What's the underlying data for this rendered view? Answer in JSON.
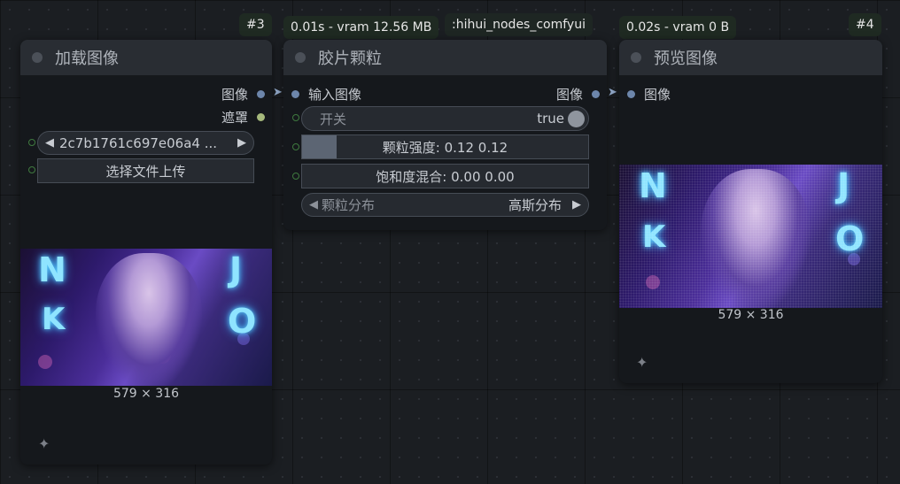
{
  "badges": {
    "node3_id": "#3",
    "node4_id": "#4",
    "grain_time": "0.01s - vram 12.56 MB",
    "grain_pack": ":hihui_nodes_comfyui",
    "preview_time": "0.02s - vram 0 B"
  },
  "load_node": {
    "title": "加载图像",
    "out_image": "图像",
    "out_mask": "遮罩",
    "file_value": "2c7b1761c697e06a4 ...",
    "upload_label": "选择文件上传",
    "image_size": "579 × 316"
  },
  "grain_node": {
    "title": "胶片颗粒",
    "in_image": "输入图像",
    "out_image": "图像",
    "toggle_label": "开关",
    "toggle_value": "true",
    "strength_label": "颗粒强度: 0.12  0.12",
    "strength_fraction": 0.12,
    "saturation_label": "饱和度混合: 0.00  0.00",
    "dist_label": "颗粒分布",
    "dist_value": "高斯分布"
  },
  "preview_node": {
    "title": "预览图像",
    "in_image": "图像",
    "image_size": "579 × 316"
  },
  "neon_letters": {
    "n": "N",
    "k": "K",
    "j": "J",
    "o": "O"
  },
  "colors": {
    "canvas_bg": "#1b1e22",
    "node_bg": "#15181c",
    "header_bg": "#292d33",
    "image_slot": "#6d86ab",
    "mask_slot": "#a6b97c"
  },
  "icons": [
    "arrow-left-icon",
    "arrow-right-icon",
    "sparkle-icon",
    "link-arrow-icon"
  ]
}
